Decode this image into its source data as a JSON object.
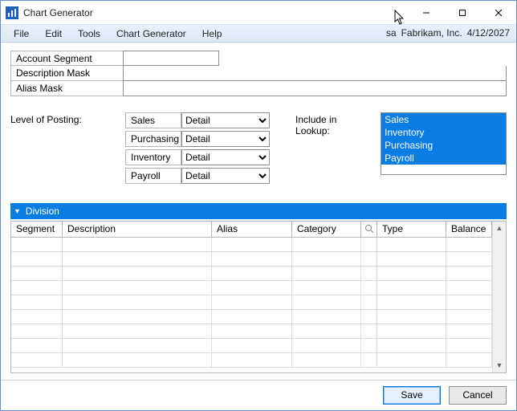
{
  "title": "Chart Generator",
  "menubar": {
    "items": [
      "File",
      "Edit",
      "Tools",
      "Chart Generator",
      "Help"
    ],
    "user": "sa",
    "company": "Fabrikam, Inc.",
    "date": "4/12/2027"
  },
  "labels": {
    "account_segment": "Account Segment",
    "description_mask": "Description Mask",
    "alias_mask": "Alias Mask",
    "level_of_posting": "Level of Posting:",
    "include_in_lookup": "Include in Lookup:"
  },
  "fields": {
    "account_segment": "",
    "description_mask": "",
    "alias_mask": ""
  },
  "posting": {
    "rows": [
      {
        "name": "Sales",
        "value": "Detail"
      },
      {
        "name": "Purchasing",
        "value": "Detail"
      },
      {
        "name": "Inventory",
        "value": "Detail"
      },
      {
        "name": "Payroll",
        "value": "Detail"
      }
    ],
    "options": [
      "Detail"
    ]
  },
  "lookup": {
    "items": [
      "Sales",
      "Inventory",
      "Purchasing",
      "Payroll"
    ]
  },
  "section": {
    "title": "Division"
  },
  "grid": {
    "columns": {
      "segment": "Segment",
      "description": "Description",
      "alias": "Alias",
      "category": "Category",
      "type": "Type",
      "balance": "Balance"
    },
    "rows": []
  },
  "buttons": {
    "save": "Save",
    "cancel": "Cancel"
  }
}
